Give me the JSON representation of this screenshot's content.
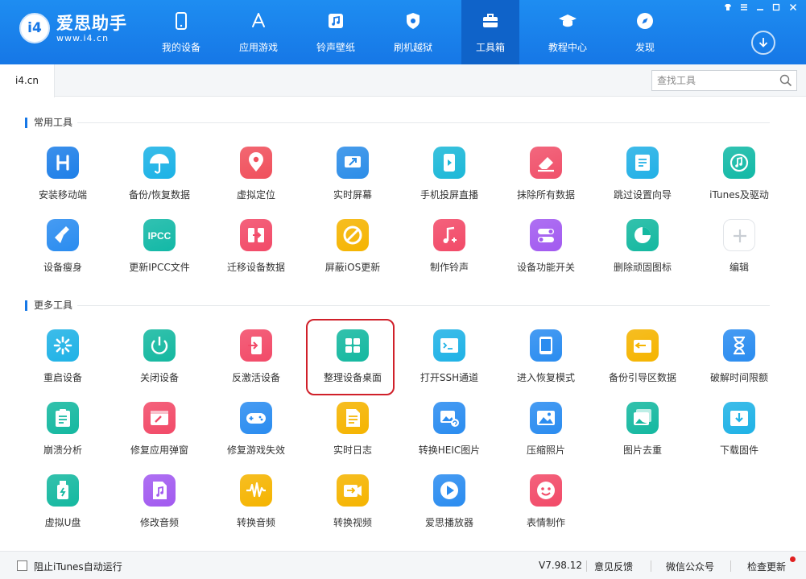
{
  "app": {
    "logo_badge": "i4",
    "logo_name": "爱思助手",
    "logo_url": "www.i4.cn"
  },
  "nav": [
    {
      "label": "我的设备",
      "icon": "phone-icon"
    },
    {
      "label": "应用游戏",
      "icon": "app-store-icon"
    },
    {
      "label": "铃声壁纸",
      "icon": "music-icon"
    },
    {
      "label": "刷机越狱",
      "icon": "shield-icon"
    },
    {
      "label": "工具箱",
      "icon": "toolbox-icon",
      "active": true
    },
    {
      "label": "教程中心",
      "icon": "graduation-cap-icon"
    },
    {
      "label": "发现",
      "icon": "compass-icon"
    }
  ],
  "tabs": [
    {
      "label": "i4.cn"
    }
  ],
  "search": {
    "placeholder": "查找工具"
  },
  "sections": [
    {
      "title": "常用工具"
    },
    {
      "title": "更多工具"
    }
  ],
  "common_tools": [
    {
      "label": "安装移动端",
      "icon": "i4-app-icon",
      "color": "#1e7fe8"
    },
    {
      "label": "备份/恢复数据",
      "icon": "umbrella-icon",
      "color": "#1bb2e6"
    },
    {
      "label": "虚拟定位",
      "icon": "location-pin-icon",
      "color": "#f0505c"
    },
    {
      "label": "实时屏幕",
      "icon": "screen-mirror-icon",
      "color": "#2c8de8"
    },
    {
      "label": "手机投屏直播",
      "icon": "phone-cast-icon",
      "color": "#1cb8d8"
    },
    {
      "label": "抹除所有数据",
      "icon": "eraser-icon",
      "color": "#f0506a"
    },
    {
      "label": "跳过设置向导",
      "icon": "setup-guide-icon",
      "color": "#22b0e6"
    },
    {
      "label": "iTunes及驱动",
      "icon": "itunes-icon",
      "color": "#12b9a6"
    },
    {
      "label": "设备瘦身",
      "icon": "broom-icon",
      "color": "#2a8cf0"
    },
    {
      "label": "更新IPCC文件",
      "icon": "ipcc-icon",
      "color": "#12b8a6"
    },
    {
      "label": "迁移设备数据",
      "icon": "migrate-icon",
      "color": "#f24a68"
    },
    {
      "label": "屏蔽iOS更新",
      "icon": "block-update-icon",
      "color": "#f5b400"
    },
    {
      "label": "制作铃声",
      "icon": "ringtone-icon",
      "color": "#f24a68"
    },
    {
      "label": "设备功能开关",
      "icon": "toggle-switch-icon",
      "color": "#a25af0"
    },
    {
      "label": "删除顽固图标",
      "icon": "pie-icon",
      "color": "#14b8a0"
    },
    {
      "label": "编辑",
      "icon": "plus-icon",
      "color": "#ffffff"
    }
  ],
  "more_tools": [
    {
      "label": "重启设备",
      "icon": "restart-spinner-icon",
      "color": "#1fb2e6"
    },
    {
      "label": "关闭设备",
      "icon": "power-icon",
      "color": "#14b8a0"
    },
    {
      "label": "反激活设备",
      "icon": "deactivate-icon",
      "color": "#f24a68"
    },
    {
      "label": "整理设备桌面",
      "icon": "grid-desktop-icon",
      "color": "#14b8a0"
    },
    {
      "label": "打开SSH通道",
      "icon": "terminal-icon",
      "color": "#1fb2e6"
    },
    {
      "label": "进入恢复模式",
      "icon": "tablet-icon",
      "color": "#2a8cf0"
    },
    {
      "label": "备份引导区数据",
      "icon": "backup-drive-icon",
      "color": "#f5b400"
    },
    {
      "label": "破解时间限额",
      "icon": "hourglass-icon",
      "color": "#2a8cf0"
    },
    {
      "label": "崩溃分析",
      "icon": "clipboard-icon",
      "color": "#14b8a0"
    },
    {
      "label": "修复应用弹窗",
      "icon": "repair-window-icon",
      "color": "#f24a68"
    },
    {
      "label": "修复游戏失效",
      "icon": "gamepad-icon",
      "color": "#2a8cf0"
    },
    {
      "label": "实时日志",
      "icon": "document-icon",
      "color": "#f5b400"
    },
    {
      "label": "转换HEIC图片",
      "icon": "convert-image-icon",
      "color": "#2a8cf0"
    },
    {
      "label": "压缩照片",
      "icon": "photo-icon",
      "color": "#2a8cf0"
    },
    {
      "label": "图片去重",
      "icon": "duplicate-photo-icon",
      "color": "#14b8a0"
    },
    {
      "label": "下载固件",
      "icon": "download-box-icon",
      "color": "#1fb2e6"
    },
    {
      "label": "虚拟U盘",
      "icon": "usb-drive-icon",
      "color": "#14b8a0"
    },
    {
      "label": "修改音频",
      "icon": "audio-file-icon",
      "color": "#a25af0"
    },
    {
      "label": "转换音频",
      "icon": "waveform-icon",
      "color": "#f5b400"
    },
    {
      "label": "转换视频",
      "icon": "video-convert-icon",
      "color": "#f5b400"
    },
    {
      "label": "爱思播放器",
      "icon": "play-icon",
      "color": "#2a8cf0"
    },
    {
      "label": "表情制作",
      "icon": "emoji-icon",
      "color": "#f24a68"
    }
  ],
  "footer": {
    "itunes_label": "阻止iTunes自动运行",
    "version": "V7.98.12",
    "feedback": "意见反馈",
    "wechat": "微信公众号",
    "update": "检查更新"
  },
  "colors": {
    "header": "#1677e6",
    "highlight": "#d0202a",
    "accent": "#1677e6"
  }
}
